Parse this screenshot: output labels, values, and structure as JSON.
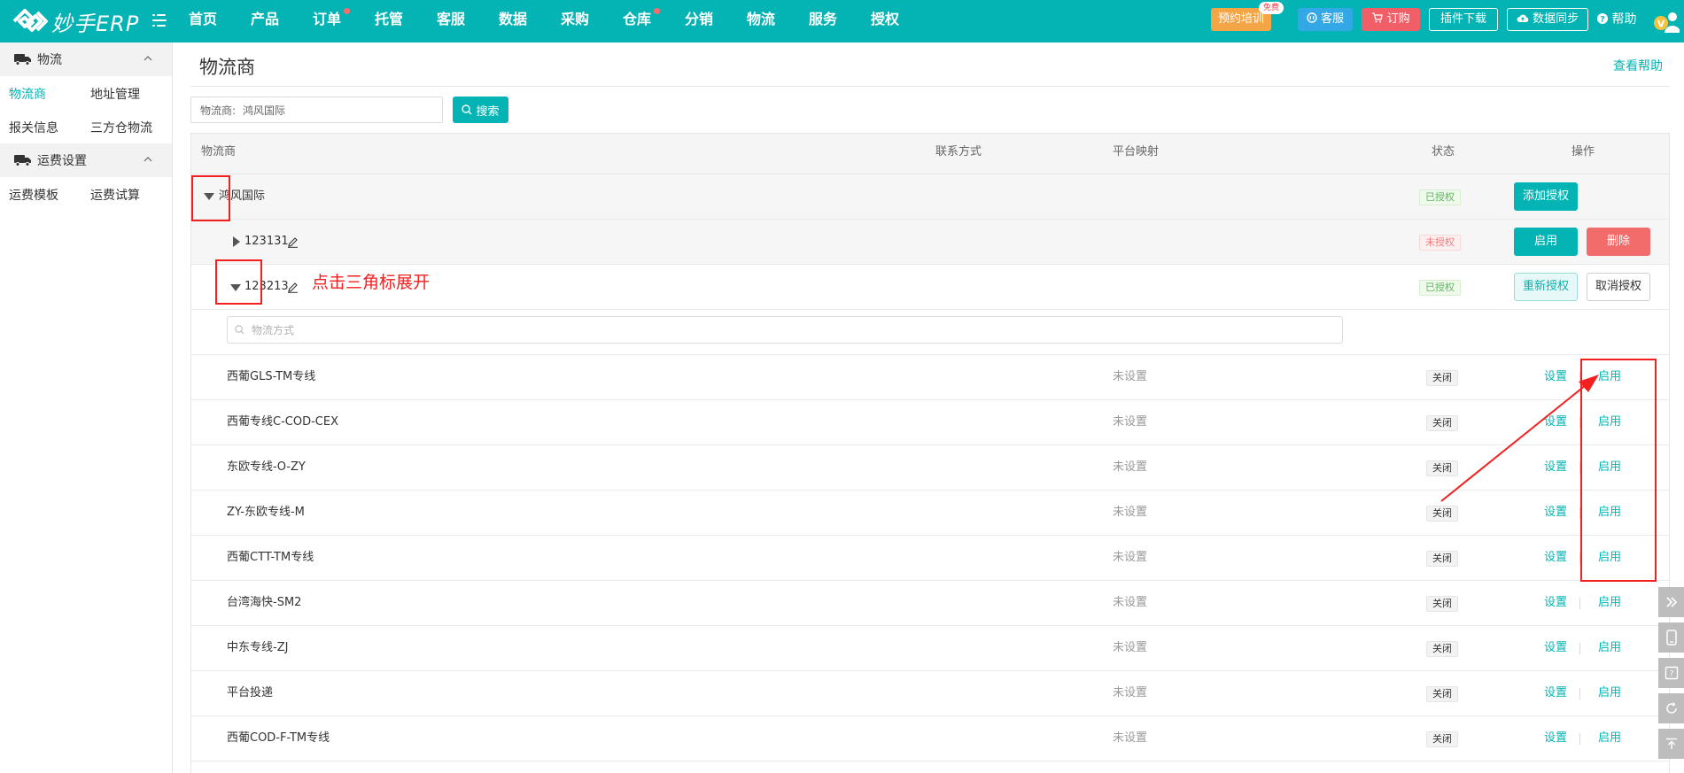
{
  "app": {
    "logo_text": "妙手ERP"
  },
  "nav": {
    "items": [
      {
        "label": "首页"
      },
      {
        "label": "产品"
      },
      {
        "label": "订单"
      },
      {
        "label": "托管"
      },
      {
        "label": "客服"
      },
      {
        "label": "数据"
      },
      {
        "label": "采购"
      },
      {
        "label": "仓库"
      },
      {
        "label": "分销"
      },
      {
        "label": "物流"
      },
      {
        "label": "服务"
      },
      {
        "label": "授权"
      }
    ],
    "train_label": "预约培训",
    "free_badge": "免费",
    "service_label": "客服",
    "order_label": "订购",
    "plugin_label": "插件下载",
    "sync_label": "数据同步",
    "help_label": "帮助",
    "avatar_letter": "V"
  },
  "sidebar": {
    "groups": [
      {
        "title": "物流",
        "links": [
          "物流商",
          "地址管理",
          "报关信息",
          "三方仓物流"
        ]
      },
      {
        "title": "运费设置",
        "links": [
          "运费模板",
          "运费试算"
        ]
      }
    ],
    "active": "物流商"
  },
  "page": {
    "title": "物流商",
    "help_link": "查看帮助",
    "filter_label": "物流商:",
    "filter_value": "鸿风国际",
    "search_button": "搜索"
  },
  "table": {
    "headers": {
      "provider": "物流商",
      "contact": "联系方式",
      "mapping": "平台映射",
      "status": "状态",
      "actions": "操作"
    },
    "provider": {
      "name": "鸿风国际",
      "status": "已授权",
      "action": "添加授权"
    },
    "accounts": [
      {
        "name": "123131",
        "status": "未授权",
        "action1": "启用",
        "action2": "删除"
      },
      {
        "name": "123213",
        "status": "已授权",
        "action1": "重新授权",
        "action2": "取消授权"
      }
    ],
    "method_search_placeholder": "物流方式",
    "methods": [
      {
        "name": "西葡GLS-TM专线",
        "mapping": "未设置",
        "status": "关闭",
        "set": "设置",
        "enable": "启用"
      },
      {
        "name": "西葡专线C-COD-CEX",
        "mapping": "未设置",
        "status": "关闭",
        "set": "设置",
        "enable": "启用"
      },
      {
        "name": "东欧专线-O-ZY",
        "mapping": "未设置",
        "status": "关闭",
        "set": "设置",
        "enable": "启用"
      },
      {
        "name": "ZY-东欧专线-M",
        "mapping": "未设置",
        "status": "关闭",
        "set": "设置",
        "enable": "启用"
      },
      {
        "name": "西葡CTT-TM专线",
        "mapping": "未设置",
        "status": "关闭",
        "set": "设置",
        "enable": "启用"
      },
      {
        "name": "台湾海快-SM2",
        "mapping": "未设置",
        "status": "关闭",
        "set": "设置",
        "enable": "启用"
      },
      {
        "name": "中东专线-ZJ",
        "mapping": "未设置",
        "status": "关闭",
        "set": "设置",
        "enable": "启用"
      },
      {
        "name": "平台投递",
        "mapping": "未设置",
        "status": "关闭",
        "set": "设置",
        "enable": "启用"
      },
      {
        "name": "西葡COD-F-TM专线",
        "mapping": "未设置",
        "status": "关闭",
        "set": "设置",
        "enable": "启用"
      }
    ]
  },
  "annotation": {
    "text": "点击三角标展开",
    "color": "#f42020"
  },
  "colors": {
    "brand": "#04b3b3",
    "danger": "#f36c6c",
    "annotation": "#f42020"
  }
}
